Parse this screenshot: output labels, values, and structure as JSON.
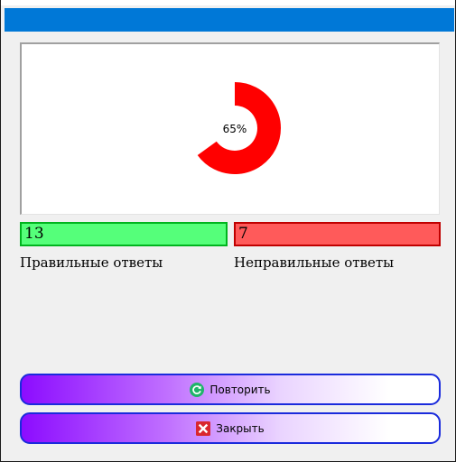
{
  "progress": {
    "percent_label": "65%",
    "value": 0.65,
    "color": "#ff0000"
  },
  "scores": {
    "correct_value": "13",
    "correct_label": "Правильные ответы",
    "correct_color": "#55ff7a",
    "wrong_value": "7",
    "wrong_label": "Неправильные ответы",
    "wrong_color": "#ff5a5a"
  },
  "buttons": {
    "retry_label": "Повторить",
    "retry_icon": "refresh-icon",
    "close_label": "Закрыть",
    "close_icon": "close-icon"
  },
  "colors": {
    "titlebar": "#0078d7",
    "button_border": "#1a2bdc",
    "button_gradient_start": "#8c0cff"
  }
}
